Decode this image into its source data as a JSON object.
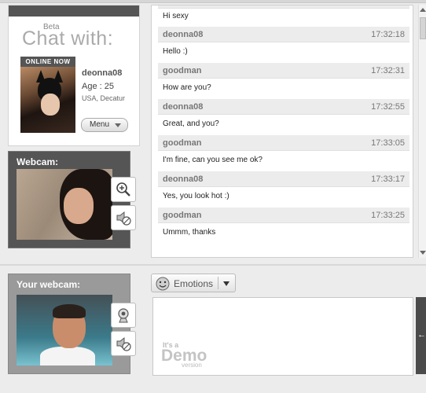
{
  "profile": {
    "beta": "Beta",
    "chat_with": "Chat with:",
    "online_badge": "ONLINE NOW",
    "username": "deonna08",
    "age": "Age : 25",
    "location": "USA, Decatur",
    "menu_label": "Menu"
  },
  "webcam": {
    "title": "Webcam:"
  },
  "your_webcam": {
    "title": "Your webcam:"
  },
  "messages": [
    {
      "user": "",
      "time": "",
      "text": "Hi sexy"
    },
    {
      "user": "deonna08",
      "time": "17:32:18",
      "text": "Hello :)"
    },
    {
      "user": "goodman",
      "time": "17:32:31",
      "text": "How are you?"
    },
    {
      "user": "deonna08",
      "time": "17:32:55",
      "text": "Great, and you?"
    },
    {
      "user": "goodman",
      "time": "17:33:05",
      "text": "I'm fine, can you see me ok?"
    },
    {
      "user": "deonna08",
      "time": "17:33:17",
      "text": "Yes, you look hot :)"
    },
    {
      "user": "goodman",
      "time": "17:33:25",
      "text": "Ummm, thanks"
    }
  ],
  "emotions": {
    "label": "Emotions"
  },
  "input": {
    "demo_small": "It's a",
    "demo_big": "Demo",
    "demo_version": "version"
  },
  "icons": [
    "zoom-in-icon",
    "sound-mute-icon",
    "webcam-icon",
    "smiley-icon",
    "dropdown-caret-icon",
    "send-arrow-icon"
  ]
}
